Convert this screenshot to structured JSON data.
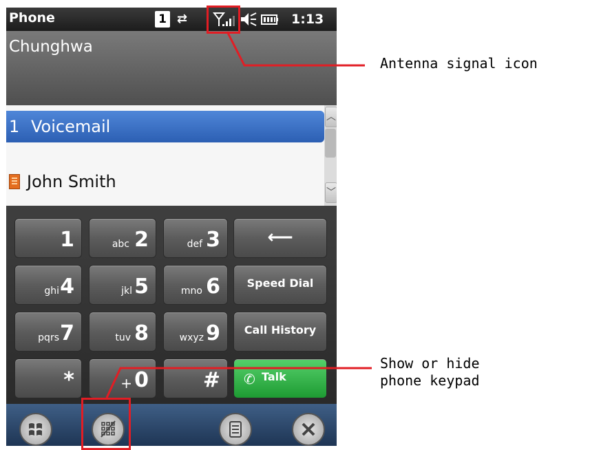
{
  "statusbar": {
    "app_title": "Phone",
    "notification_count": "1",
    "time": "1:13"
  },
  "carrier": "Chunghwa",
  "list": {
    "items": [
      {
        "number": "1",
        "label": "Voicemail",
        "selected": true
      },
      {
        "label": "John Smith",
        "icon": "contact-card-icon"
      }
    ]
  },
  "keypad": {
    "keys": [
      {
        "digit": "1",
        "letters": ""
      },
      {
        "digit": "2",
        "letters": "abc"
      },
      {
        "digit": "3",
        "letters": "def"
      },
      {
        "digit": "4",
        "letters": "ghi"
      },
      {
        "digit": "5",
        "letters": "jkl"
      },
      {
        "digit": "6",
        "letters": "mno"
      },
      {
        "digit": "7",
        "letters": "pqrs"
      },
      {
        "digit": "8",
        "letters": "tuv"
      },
      {
        "digit": "9",
        "letters": "wxyz"
      },
      {
        "digit": "*",
        "letters": ""
      },
      {
        "digit": "0",
        "letters": "+"
      },
      {
        "digit": "#",
        "letters": ""
      }
    ],
    "backspace": "⟵",
    "speed_dial": "Speed Dial",
    "call_history": "Call History",
    "talk": "Talk"
  },
  "annotations": {
    "antenna": "Antenna signal icon",
    "keypad_line1": "Show or hide",
    "keypad_line2": "phone keypad"
  },
  "colors": {
    "callout": "#e21d24",
    "selection": "#3a6fc4",
    "talk": "#2fb545"
  }
}
